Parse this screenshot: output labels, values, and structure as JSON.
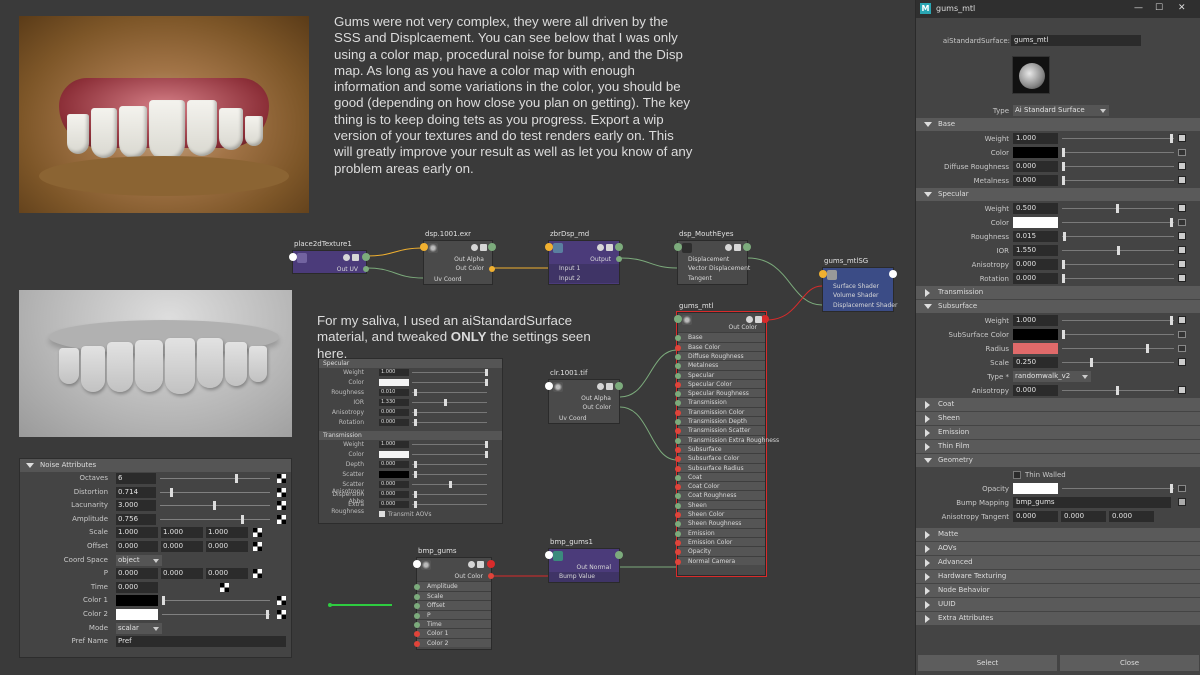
{
  "canvas": {
    "note_top": "Gums were not very complex, they were all driven by the SSS and Displcaement. You can see below that I was only using a color map, procedural noise for bump, and the Disp map. As long as you have a color map with enough information and some variations in the color, you should be good (depending  on how close you plan on getting). The key thing is to keep doing tets as you progress. Export a wip version of your textures and do test renders early on. This will greatly improve your result as well as let you know of any problem areas early on.",
    "note_bottom_pre": "For my saliva, I used an aiStandardSurface material, and tweaked ",
    "note_bottom_bold": "ONLY",
    "note_bottom_post": " the settings seen here."
  },
  "nodes": {
    "place2d": {
      "title": "place2dTexture1",
      "out": "Out UV"
    },
    "dsp1001": {
      "title": "dsp.1001.exr",
      "out1": "Out Alpha",
      "out2": "Out Color",
      "in1": "Uv Coord"
    },
    "zbr": {
      "title": "zbrDsp_md",
      "out": "Output",
      "in1": "Input 1",
      "in2": "Input 2"
    },
    "dspMouth": {
      "title": "dsp_MouthEyes",
      "in1": "Displacement",
      "in2": "Vector Displacement",
      "in3": "Tangent"
    },
    "gumsSG": {
      "title": "gums_mtlSG",
      "in1": "Surface Shader",
      "in2": "Volume Shader",
      "in3": "Displacement Shader"
    },
    "clr": {
      "title": "clr.1001.tif",
      "out1": "Out Alpha",
      "out2": "Out Color",
      "in1": "Uv Coord"
    },
    "bmpGums": {
      "title": "bmp_gums",
      "out": "Out Color",
      "ins": [
        "Amplitude",
        "Scale",
        "Offset",
        "P",
        "Time",
        "Color 1",
        "Color 2"
      ]
    },
    "bmpGums1": {
      "title": "bmp_gums1",
      "out": "Out Normal",
      "in1": "Bump Value"
    },
    "gumsMtl": {
      "title": "gums_mtl",
      "out": "Out Color",
      "ins": [
        "Base",
        "Base Color",
        "Diffuse Roughness",
        "Metalness",
        "Specular",
        "Specular Color",
        "Specular Roughness",
        "Transmission",
        "Transmission Color",
        "Transmission Depth",
        "Transmission Scatter",
        "Transmission Extra Roughness",
        "Subsurface",
        "Subsurface Color",
        "Subsurface Radius",
        "Coat",
        "Coat Color",
        "Coat Roughness",
        "Sheen",
        "Sheen Color",
        "Sheen Roughness",
        "Emission",
        "Emission Color",
        "Opacity",
        "Normal Camera"
      ]
    }
  },
  "saliva": {
    "spec_header": "Specular",
    "spec_rows": [
      {
        "label": "Weight",
        "value": "1.000"
      },
      {
        "label": "Color",
        "value": ""
      },
      {
        "label": "Roughness",
        "value": "0.010"
      },
      {
        "label": "IOR",
        "value": "1.330"
      },
      {
        "label": "Anisotropy",
        "value": "0.000"
      },
      {
        "label": "Rotation",
        "value": "0.000"
      }
    ],
    "trans_header": "Transmission",
    "trans_rows": [
      {
        "label": "Weight",
        "value": "1.000"
      },
      {
        "label": "Color",
        "value": ""
      },
      {
        "label": "Depth",
        "value": "0.000"
      },
      {
        "label": "Scatter",
        "value": ""
      },
      {
        "label": "Scatter Anisotropy",
        "value": "0.000"
      },
      {
        "label": "Dispersion Abbe",
        "value": "0.000"
      },
      {
        "label": "Extra Roughness",
        "value": "0.000"
      }
    ],
    "check": "Transmit AOVs"
  },
  "noise": {
    "header": "Noise Attributes",
    "octaves": {
      "label": "Octaves",
      "value": "6"
    },
    "distortion": {
      "label": "Distortion",
      "value": "0.714"
    },
    "lacunarity": {
      "label": "Lacunarity",
      "value": "3.000"
    },
    "amplitude": {
      "label": "Amplitude",
      "value": "0.756"
    },
    "scale": {
      "label": "Scale",
      "v1": "1.000",
      "v2": "1.000",
      "v3": "1.000"
    },
    "offset": {
      "label": "Offset",
      "v1": "0.000",
      "v2": "0.000",
      "v3": "0.000"
    },
    "coordspace": {
      "label": "Coord Space",
      "value": "object"
    },
    "p": {
      "label": "P",
      "v1": "0.000",
      "v2": "0.000",
      "v3": "0.000"
    },
    "time": {
      "label": "Time",
      "value": "0.000"
    },
    "color1": {
      "label": "Color 1"
    },
    "color2": {
      "label": "Color 2"
    },
    "mode": {
      "label": "Mode",
      "value": "scalar"
    },
    "prefname": {
      "label": "Pref Name",
      "value": "Pref"
    }
  },
  "panel": {
    "window_title": "gums_mtl",
    "shader_label": "aiStandardSurface:",
    "shader_name": "gums_mtl",
    "type_label": "Type",
    "type_value": "Ai Standard Surface",
    "sections": {
      "base": "Base",
      "specular": "Specular",
      "transmission": "Transmission",
      "subsurface": "Subsurface",
      "coat": "Coat",
      "sheen": "Sheen",
      "emission": "Emission",
      "thinfilm": "Thin Film",
      "geometry": "Geometry",
      "matte": "Matte",
      "aovs": "AOVs",
      "advanced": "Advanced",
      "hwtex": "Hardware Texturing",
      "nodebeh": "Node Behavior",
      "uuid": "UUID",
      "extra": "Extra Attributes"
    },
    "base": {
      "weight": {
        "label": "Weight",
        "value": "1.000"
      },
      "color": {
        "label": "Color"
      },
      "diffrough": {
        "label": "Diffuse Roughness",
        "value": "0.000"
      },
      "metal": {
        "label": "Metalness",
        "value": "0.000"
      }
    },
    "specular": {
      "weight": {
        "label": "Weight",
        "value": "0.500"
      },
      "color": {
        "label": "Color"
      },
      "rough": {
        "label": "Roughness",
        "value": "0.015"
      },
      "ior": {
        "label": "IOR",
        "value": "1.550"
      },
      "aniso": {
        "label": "Anisotropy",
        "value": "0.000"
      },
      "rot": {
        "label": "Rotation",
        "value": "0.000"
      }
    },
    "subsurface": {
      "weight": {
        "label": "Weight",
        "value": "1.000"
      },
      "sscolor": {
        "label": "SubSurface Color"
      },
      "radius": {
        "label": "Radius"
      },
      "scale": {
        "label": "Scale",
        "value": "0.250"
      },
      "type": {
        "label": "Type *",
        "value": "randomwalk_v2"
      },
      "aniso": {
        "label": "Anisotropy",
        "value": "0.000"
      }
    },
    "geometry": {
      "thin": "Thin Walled",
      "opacity": {
        "label": "Opacity"
      },
      "bump": {
        "label": "Bump Mapping",
        "value": "bmp_gums"
      },
      "atangent": {
        "label": "Anisotropy Tangent",
        "v1": "0.000",
        "v2": "0.000",
        "v3": "0.000"
      }
    },
    "select": "Select",
    "close": "Close"
  },
  "colors": {
    "radius_swatch": "#e06a6a",
    "selection": "#d92b2b",
    "connection": "#7cab7c"
  }
}
